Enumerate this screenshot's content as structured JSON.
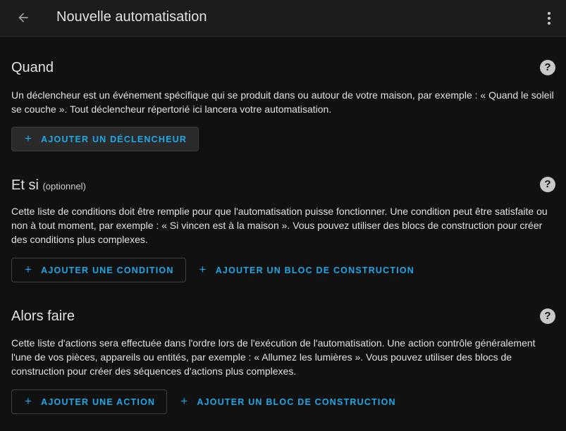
{
  "header": {
    "title": "Nouvelle automatisation",
    "back_icon": "arrow-left-icon",
    "menu_icon": "dots-vertical-icon"
  },
  "sections": {
    "quand": {
      "title": "Quand",
      "description": "Un déclencheur est un événement spécifique qui se produit dans ou autour de votre maison, par exemple : « Quand le soleil se couche ». Tout déclencheur répertorié ici lancera votre automatisation.",
      "add_trigger": "AJOUTER UN DÉCLENCHEUR"
    },
    "et_si": {
      "title": "Et si",
      "optional": "(optionnel)",
      "description": "Cette liste de conditions doit être remplie pour que l'automatisation puisse fonctionner. Une condition peut être satisfaite ou non à tout moment, par exemple : « Si vincen est à la maison ». Vous pouvez utiliser des blocs de construction pour créer des conditions plus complexes.",
      "add_condition": "AJOUTER UNE CONDITION",
      "add_block": "AJOUTER UN BLOC DE CONSTRUCTION"
    },
    "alors_faire": {
      "title": "Alors faire",
      "description": "Cette liste d'actions sera effectuée dans l'ordre lors de l'exécution de l'automatisation. Une action contrôle généralement l'une de vos pièces, appareils ou entités, par exemple : « Allumez les lumières ». Vous pouvez utiliser des blocs de construction pour créer des séquences d'actions plus complexes.",
      "add_action": "AJOUTER UNE ACTION",
      "add_block": "AJOUTER UN BLOC DE CONSTRUCTION"
    }
  },
  "help_icon_glyph": "?",
  "plus_glyph": "+",
  "colors": {
    "background": "#111111",
    "topbar": "#1c1c1c",
    "accent": "#1fa8e8",
    "text": "#e1e1e1"
  }
}
